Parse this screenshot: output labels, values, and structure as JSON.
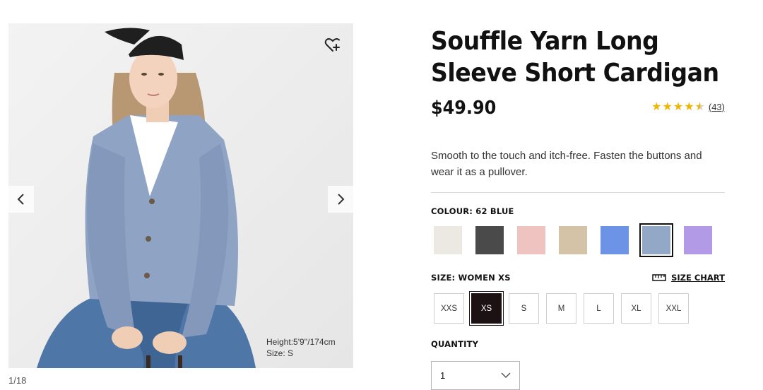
{
  "gallery": {
    "counter": "1/18",
    "model_height": "Height:5'9''/174cm",
    "model_size": "Size: S"
  },
  "product": {
    "title_line1": "Souffle Yarn Long",
    "title_line2": "Sleeve Short Cardigan",
    "price": "$49.90",
    "rating": 4.5,
    "review_count": "(43)",
    "description": "Smooth to the touch and itch-free. Fasten the buttons and wear it as a pullover."
  },
  "colour": {
    "label": "COLOUR: 62 BLUE",
    "swatches": [
      {
        "name": "off-white",
        "color": "#ece9e3"
      },
      {
        "name": "dark-gray",
        "color": "#4a4a4a"
      },
      {
        "name": "pink",
        "color": "#efc3bf"
      },
      {
        "name": "beige",
        "color": "#d4c3a6"
      },
      {
        "name": "bright-blue",
        "color": "#6c93e6"
      },
      {
        "name": "blue",
        "color": "#93a7c7",
        "selected": true
      },
      {
        "name": "purple",
        "color": "#b39ae6"
      }
    ]
  },
  "size": {
    "label": "SIZE: WOMEN XS",
    "chart_label": "SIZE CHART",
    "options": [
      "XXS",
      "XS",
      "S",
      "M",
      "L",
      "XL",
      "XXL"
    ],
    "selected": "XS"
  },
  "quantity": {
    "label": "QUANTITY",
    "value": "1"
  }
}
